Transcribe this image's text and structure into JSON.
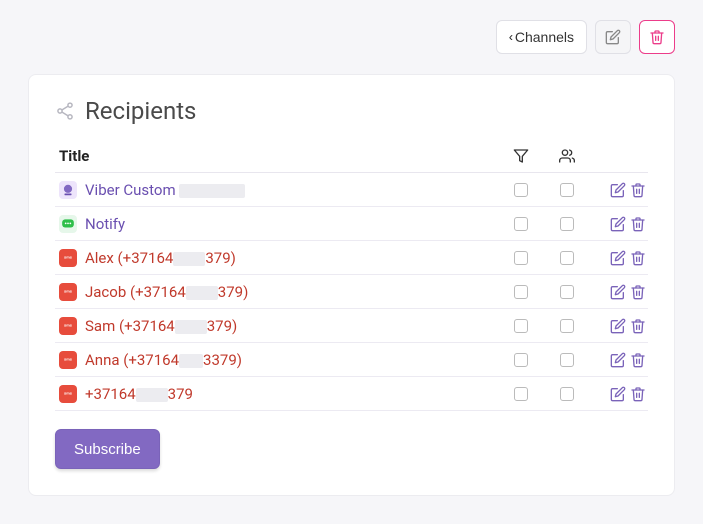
{
  "toolbar": {
    "channels_label": "Channels"
  },
  "card": {
    "title": "Recipients",
    "columns": {
      "title": "Title"
    },
    "subscribe_label": "Subscribe"
  },
  "rows": [
    {
      "icon": "viber",
      "title_parts": [
        "Viber Custom "
      ],
      "redact_width": 66,
      "title_suffix": "",
      "link": true
    },
    {
      "icon": "line",
      "title_parts": [
        "Notify"
      ],
      "redact_width": 0,
      "title_suffix": "",
      "link": true
    },
    {
      "icon": "sms",
      "title_parts": [
        "Alex (+37164"
      ],
      "redact_width": 32,
      "title_suffix": "379)",
      "link": false
    },
    {
      "icon": "sms",
      "title_parts": [
        "Jacob (+37164"
      ],
      "redact_width": 32,
      "title_suffix": "379)",
      "link": false
    },
    {
      "icon": "sms",
      "title_parts": [
        "Sam (+37164"
      ],
      "redact_width": 32,
      "title_suffix": "379)",
      "link": false
    },
    {
      "icon": "sms",
      "title_parts": [
        "Anna (+37164"
      ],
      "redact_width": 24,
      "title_suffix": "3379)",
      "link": false
    },
    {
      "icon": "sms",
      "title_parts": [
        "+37164"
      ],
      "redact_width": 32,
      "title_suffix": "379",
      "link": false
    }
  ]
}
